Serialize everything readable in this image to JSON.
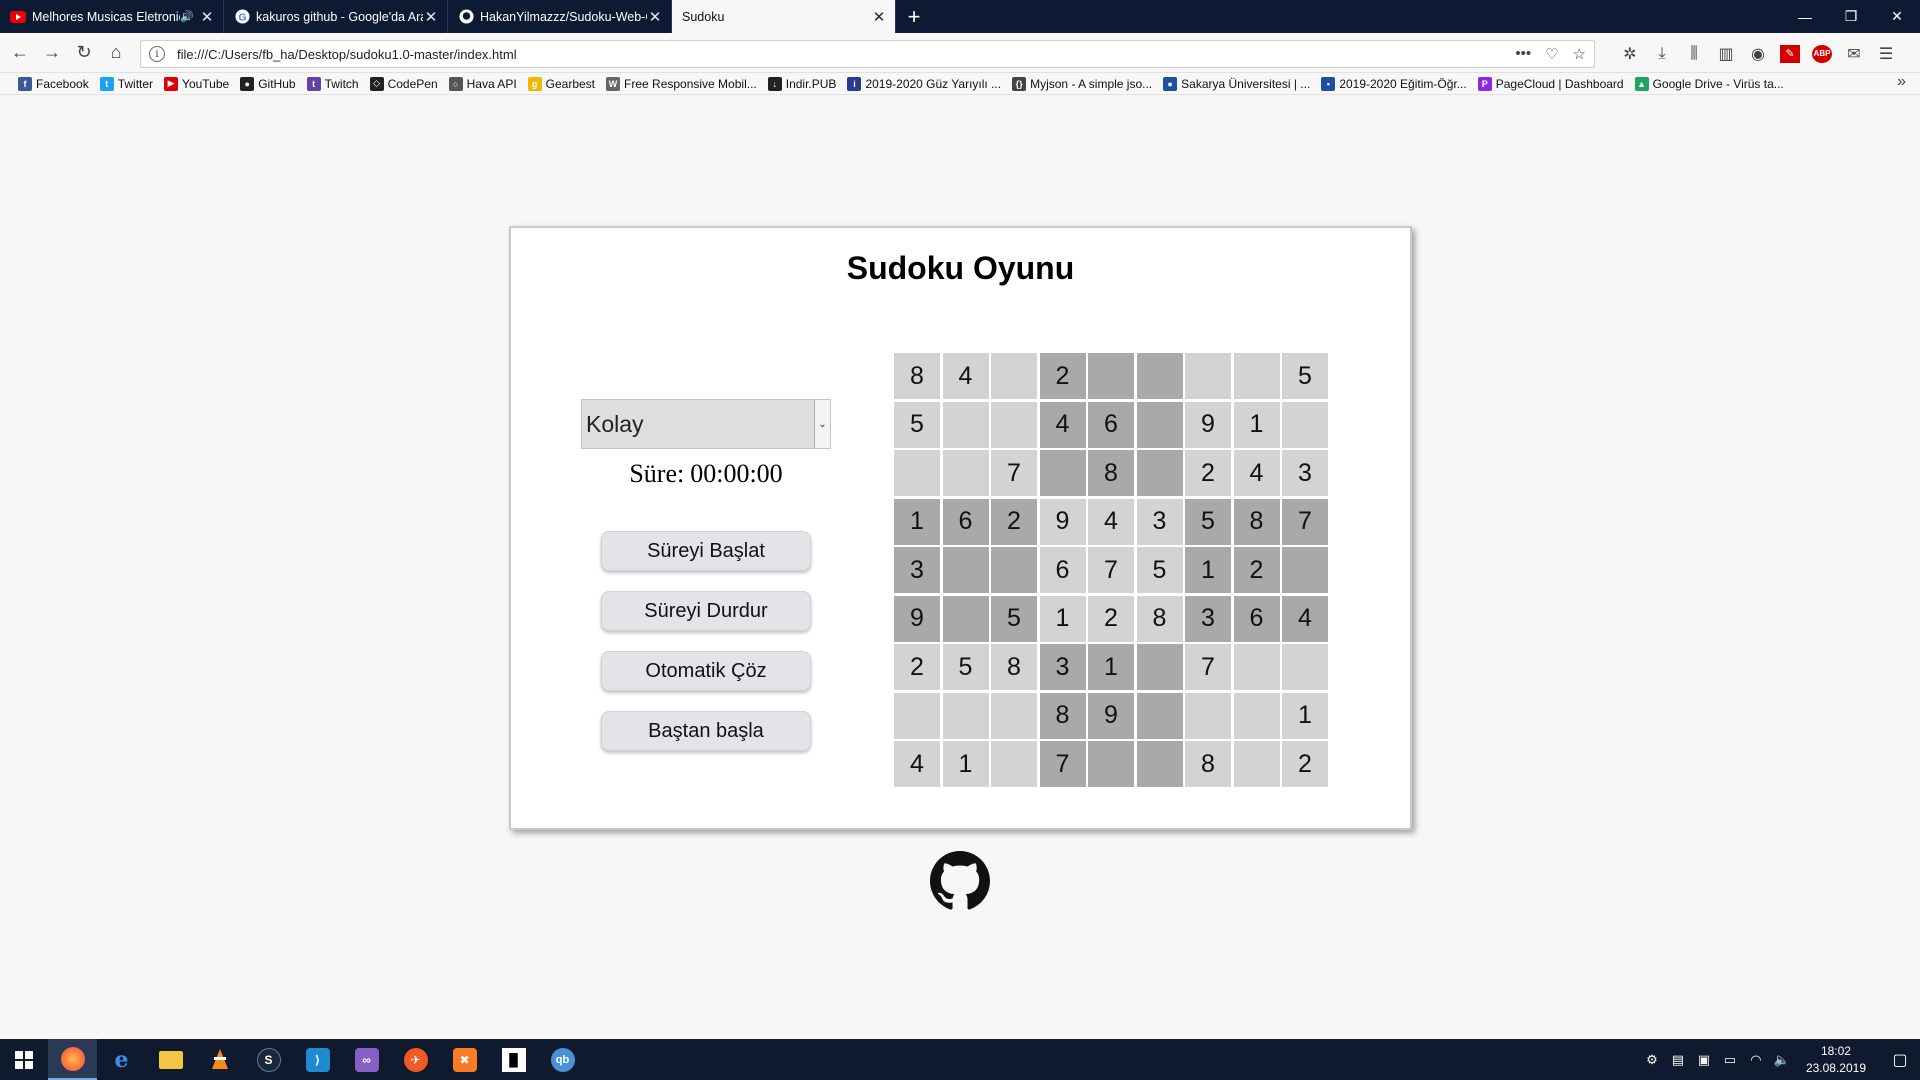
{
  "browser": {
    "tabs": [
      {
        "label": "Melhores Musicas Eletronic",
        "icon": "youtube-icon",
        "sound": "🔊"
      },
      {
        "label": "kakuros github - Google'da Ara",
        "icon": "google-icon"
      },
      {
        "label": "HakanYilmazzz/Sudoku-Web-G",
        "icon": "github-icon"
      },
      {
        "label": "Sudoku",
        "icon": "",
        "active": true
      }
    ],
    "new_tab": "+",
    "window_controls": {
      "minimize": "—",
      "maximize": "❐",
      "close": "✕"
    },
    "url": "file:///C:/Users/fb_ha/Desktop/sudoku1.0-master/index.html",
    "url_icons": {
      "more": "•••",
      "pocket": "♡",
      "star": "☆"
    },
    "bookmarks": [
      {
        "label": "Facebook",
        "icon": "facebook-icon",
        "color": "#3b5998",
        "glyph": "f"
      },
      {
        "label": "Twitter",
        "icon": "twitter-icon",
        "color": "#1da1f2",
        "glyph": "t"
      },
      {
        "label": "YouTube",
        "icon": "youtube-icon",
        "color": "#e00000",
        "glyph": "▶"
      },
      {
        "label": "GitHub",
        "icon": "github-icon",
        "color": "#222222",
        "glyph": "●"
      },
      {
        "label": "Twitch",
        "icon": "twitch-icon",
        "color": "#6441a5",
        "glyph": "t"
      },
      {
        "label": "CodePen",
        "icon": "codepen-icon",
        "color": "#222222",
        "glyph": "◇"
      },
      {
        "label": "Hava API",
        "icon": "globe-icon",
        "color": "#555555",
        "glyph": "○"
      },
      {
        "label": "Gearbest",
        "icon": "gearbest-icon",
        "color": "#f2b705",
        "glyph": "g"
      },
      {
        "label": "Free Responsive Mobil...",
        "icon": "w3-icon",
        "color": "#666666",
        "glyph": "W"
      },
      {
        "label": "Indir.PUB",
        "icon": "indir-icon",
        "color": "#222222",
        "glyph": "↓"
      },
      {
        "label": "2019-2020 Güz Yarıyılı ...",
        "icon": "info-icon",
        "color": "#2b3a8c",
        "glyph": "i"
      },
      {
        "label": "Myjson - A simple jso...",
        "icon": "braces-icon",
        "color": "#444444",
        "glyph": "{}"
      },
      {
        "label": "Sakarya Üniversitesi | ...",
        "icon": "university-icon",
        "color": "#1f4fa0",
        "glyph": "●"
      },
      {
        "label": "2019-2020 Eğitim-Öğr...",
        "icon": "document-icon",
        "color": "#1f4fa0",
        "glyph": "▪"
      },
      {
        "label": "PageCloud | Dashboard",
        "icon": "pagecloud-icon",
        "color": "#8a2be2",
        "glyph": "P"
      },
      {
        "label": "Google Drive - Virüs ta...",
        "icon": "google-drive-icon",
        "color": "#1fa463",
        "glyph": "▲"
      }
    ],
    "bookmarks_more": "»"
  },
  "page": {
    "title": "Sudoku Oyunu",
    "difficulty": {
      "selected": "Kolay"
    },
    "timer": {
      "label": "Süre:",
      "value": "00:00:00"
    },
    "buttons": {
      "start": "Süreyi Başlat",
      "stop": "Süreyi Durdur",
      "solve": "Otomatik Çöz",
      "restart": "Baştan başla"
    },
    "board": [
      [
        "8",
        "4",
        "",
        "2",
        "",
        "",
        "",
        "",
        "5"
      ],
      [
        "5",
        "",
        "",
        "4",
        "6",
        "",
        "9",
        "1",
        ""
      ],
      [
        "",
        "",
        "7",
        "",
        "8",
        "",
        "2",
        "4",
        "3"
      ],
      [
        "1",
        "6",
        "2",
        "9",
        "4",
        "3",
        "5",
        "8",
        "7"
      ],
      [
        "3",
        "",
        "",
        "6",
        "7",
        "5",
        "1",
        "2",
        ""
      ],
      [
        "9",
        "",
        "5",
        "1",
        "2",
        "8",
        "3",
        "6",
        "4"
      ],
      [
        "2",
        "5",
        "8",
        "3",
        "1",
        "",
        "7",
        "",
        ""
      ],
      [
        "",
        "",
        "",
        "8",
        "9",
        "",
        "",
        "",
        "1"
      ],
      [
        "4",
        "1",
        "",
        "7",
        "",
        "",
        "8",
        "",
        "2"
      ]
    ],
    "colors": {
      "light_cell": "#d3d3d3",
      "dark_cell": "#a9a9a9"
    }
  },
  "taskbar": {
    "apps": [
      "firefox-icon",
      "edge-icon",
      "file-explorer-icon",
      "vlc-icon",
      "steam-icon",
      "vscode-icon",
      "visual-studio-icon",
      "postman-icon",
      "xampp-icon",
      "jetbrains-icon",
      "qbittorrent-icon"
    ],
    "clock_time": "18:02",
    "clock_date": "23.08.2019"
  }
}
